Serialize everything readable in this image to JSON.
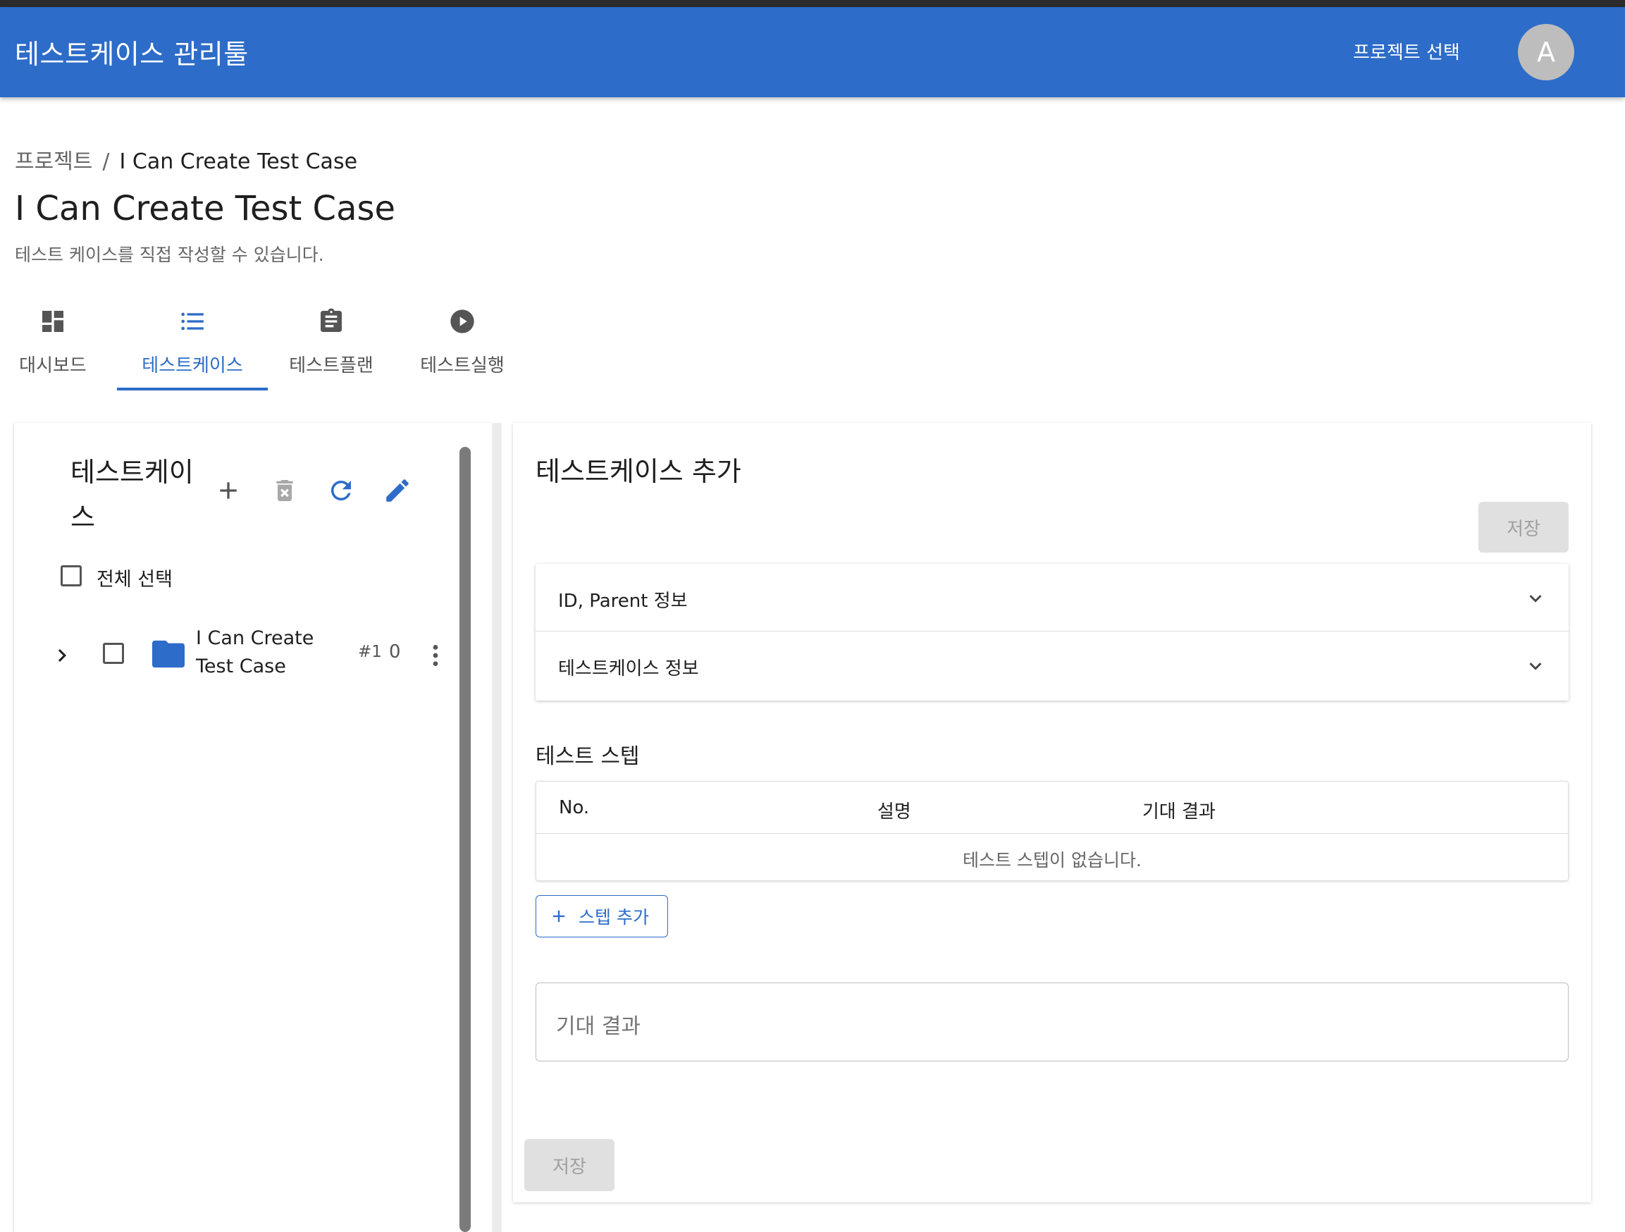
{
  "appbar": {
    "title": "테스트케이스 관리툴",
    "project_select": "프로젝트 선택",
    "avatar_letter": "A"
  },
  "breadcrumb": {
    "root": "프로젝트",
    "separator": "/",
    "current": "I Can Create Test Case"
  },
  "page": {
    "title": "I Can Create Test Case",
    "description": "테스트 케이스를 직접 작성할 수 있습니다."
  },
  "tabs": [
    {
      "label": "대시보드",
      "icon": "dashboard-icon"
    },
    {
      "label": "테스트케이스",
      "icon": "list-icon",
      "active": true
    },
    {
      "label": "테스트플랜",
      "icon": "clipboard-icon"
    },
    {
      "label": "테스트실행",
      "icon": "play-circle-icon"
    }
  ],
  "left_panel": {
    "title": "테스트케이스",
    "select_all_label": "전체 선택",
    "tree": [
      {
        "name_line1": "I Can Create",
        "name_line2": "Test Case",
        "id": "#1",
        "count": "0"
      }
    ]
  },
  "right_panel": {
    "title": "테스트케이스 추가",
    "save_label": "저장",
    "accordion": [
      {
        "label": "ID, Parent 정보"
      },
      {
        "label": "테스트케이스 정보"
      }
    ],
    "steps": {
      "title": "테스트 스텝",
      "columns": [
        "No.",
        "설명",
        "기대 결과"
      ],
      "empty_text": "테스트 스텝이 없습니다.",
      "add_label": "스텝 추가"
    },
    "expected_result_placeholder": "기대 결과"
  },
  "colors": {
    "primary": "#2d6cc8",
    "disabled_bg": "#e0e0e0",
    "disabled_text": "#a0a0a0"
  }
}
